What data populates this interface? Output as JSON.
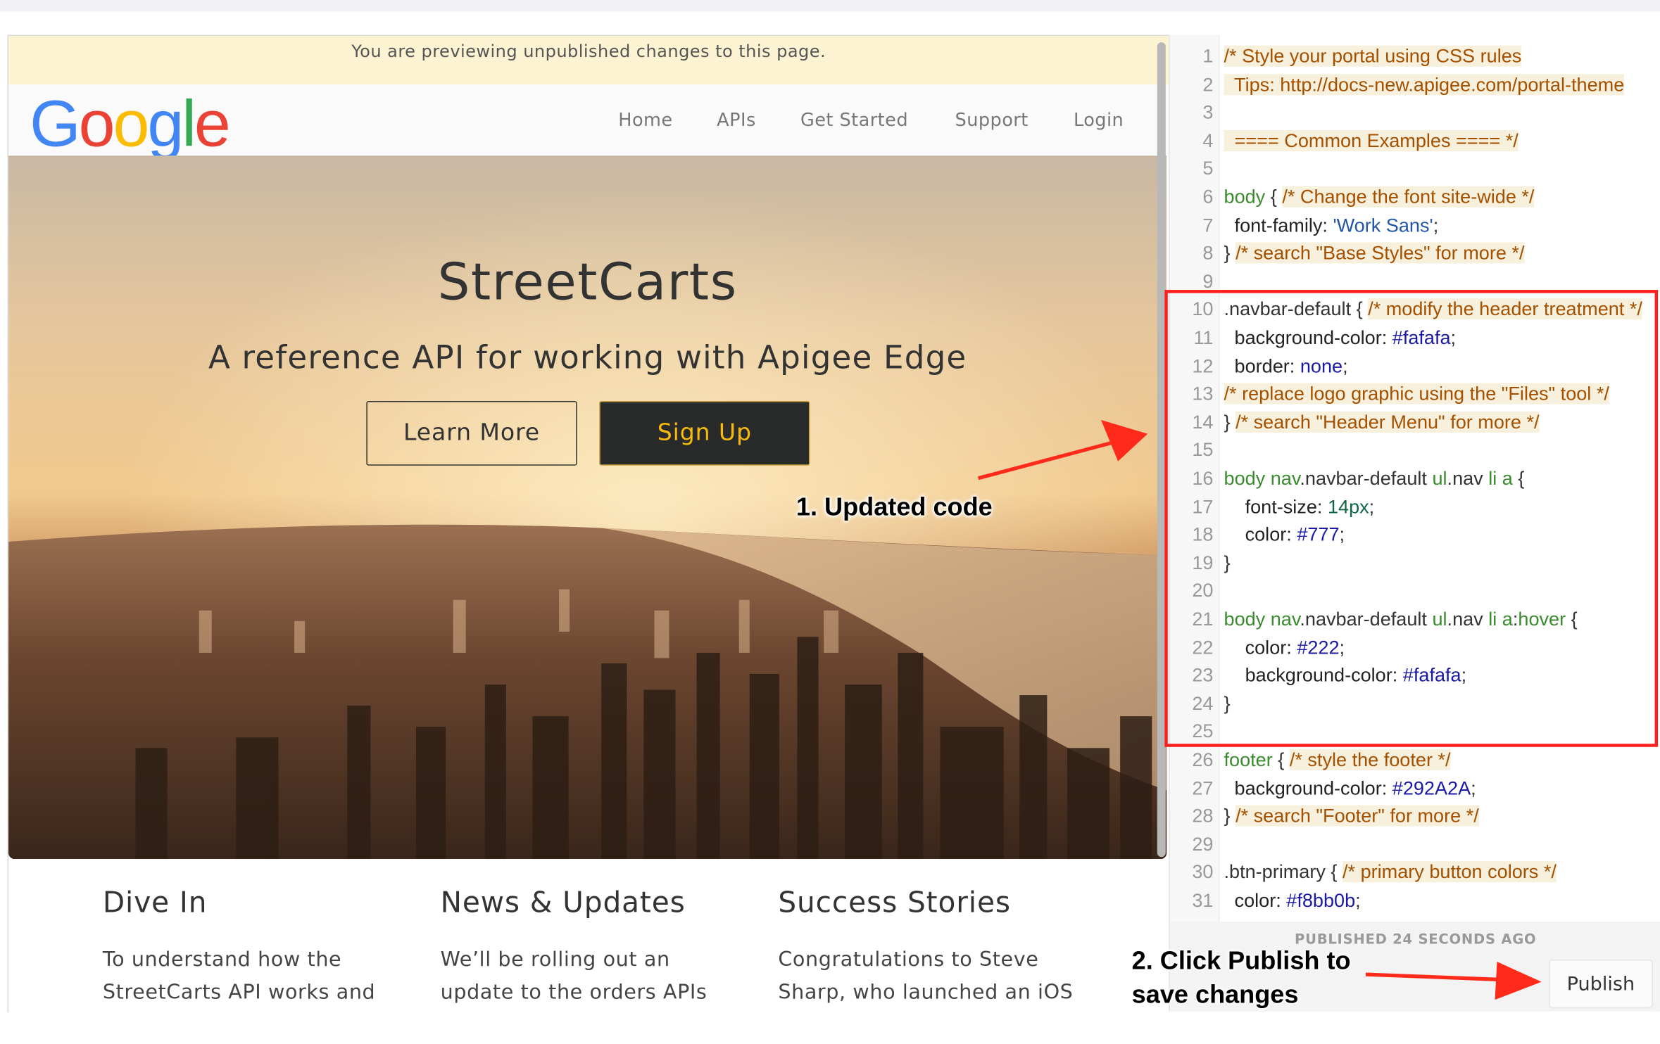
{
  "preview": {
    "banner": "You are previewing unpublished changes to this page.",
    "logo_text": [
      "G",
      "o",
      "o",
      "g",
      "l",
      "e"
    ],
    "logo_colors": [
      "#4285F4",
      "#EA4335",
      "#FBBC05",
      "#4285F4",
      "#34A853",
      "#EA4335"
    ],
    "nav": [
      "Home",
      "APIs",
      "Get Started",
      "Support",
      "Login"
    ],
    "hero": {
      "title": "StreetCarts",
      "subtitle": "A reference API for working with Apigee Edge",
      "learn_more": "Learn More",
      "sign_up": "Sign Up"
    },
    "columns": [
      {
        "title": "Dive In",
        "text_lines": [
          "To understand how the",
          "StreetCarts API works and"
        ]
      },
      {
        "title": "News & Updates",
        "text_lines": [
          "We’ll be rolling out an",
          "update to the orders APIs"
        ]
      },
      {
        "title": "Success Stories",
        "text_lines": [
          "Congratulations to Steve",
          "Sharp, who launched an iOS"
        ]
      }
    ]
  },
  "editor": {
    "lines": [
      {
        "n": "1",
        "tokens": [
          [
            "cm",
            "/* Style your portal using CSS rules"
          ]
        ]
      },
      {
        "n": "2",
        "tokens": [
          [
            "cm",
            "  Tips: http://docs-new.apigee.com/portal-theme"
          ]
        ]
      },
      {
        "n": "3",
        "tokens": []
      },
      {
        "n": "4",
        "tokens": [
          [
            "cm",
            "  ==== Common Examples ==== */"
          ]
        ]
      },
      {
        "n": "5",
        "tokens": []
      },
      {
        "n": "6",
        "tokens": [
          [
            "tag",
            "body"
          ],
          [
            "pl",
            " { "
          ],
          [
            "cm",
            "/* Change the font site-wide */"
          ]
        ]
      },
      {
        "n": "7",
        "tokens": [
          [
            "pr",
            "  font-family: "
          ],
          [
            "str",
            "'Work Sans'"
          ],
          [
            "pl",
            ";"
          ]
        ]
      },
      {
        "n": "8",
        "tokens": [
          [
            "pl",
            "} "
          ],
          [
            "cm",
            "/* search \"Base Styles\" for more */"
          ]
        ]
      },
      {
        "n": "9",
        "tokens": []
      },
      {
        "n": "10",
        "tokens": [
          [
            "pl",
            ".navbar-default { "
          ],
          [
            "cm",
            "/* modify the header treatment */"
          ]
        ]
      },
      {
        "n": "11",
        "tokens": [
          [
            "pr",
            "  background-color: "
          ],
          [
            "val",
            "#fafafa"
          ],
          [
            "pl",
            ";"
          ]
        ]
      },
      {
        "n": "12",
        "tokens": [
          [
            "pr",
            "  border: "
          ],
          [
            "val",
            "none"
          ],
          [
            "pl",
            ";"
          ]
        ]
      },
      {
        "n": "13",
        "tokens": [
          [
            "cm",
            "/* replace logo graphic using the \"Files\" tool */"
          ]
        ]
      },
      {
        "n": "14",
        "tokens": [
          [
            "pl",
            "} "
          ],
          [
            "cm",
            "/* search \"Header Menu\" for more */"
          ]
        ]
      },
      {
        "n": "15",
        "tokens": []
      },
      {
        "n": "16",
        "tokens": [
          [
            "tag",
            "body nav"
          ],
          [
            "pl",
            ".navbar-default "
          ],
          [
            "tag",
            "ul"
          ],
          [
            "pl",
            ".nav "
          ],
          [
            "tag",
            "li a"
          ],
          [
            "pl",
            " {"
          ]
        ]
      },
      {
        "n": "17",
        "tokens": [
          [
            "pr",
            "    font-size: "
          ],
          [
            "num",
            "14px"
          ],
          [
            "pl",
            ";"
          ]
        ]
      },
      {
        "n": "18",
        "tokens": [
          [
            "pr",
            "    color: "
          ],
          [
            "val",
            "#777"
          ],
          [
            "pl",
            ";"
          ]
        ]
      },
      {
        "n": "19",
        "tokens": [
          [
            "pl",
            "}"
          ]
        ]
      },
      {
        "n": "20",
        "tokens": []
      },
      {
        "n": "21",
        "tokens": [
          [
            "tag",
            "body nav"
          ],
          [
            "pl",
            ".navbar-default "
          ],
          [
            "tag",
            "ul"
          ],
          [
            "pl",
            ".nav "
          ],
          [
            "tag",
            "li a"
          ],
          [
            "pl",
            ":"
          ],
          [
            "tag",
            "hover"
          ],
          [
            "pl",
            " {"
          ]
        ]
      },
      {
        "n": "22",
        "tokens": [
          [
            "pr",
            "    color: "
          ],
          [
            "val",
            "#222"
          ],
          [
            "pl",
            ";"
          ]
        ]
      },
      {
        "n": "23",
        "tokens": [
          [
            "pr",
            "    background-color: "
          ],
          [
            "val",
            "#fafafa"
          ],
          [
            "pl",
            ";"
          ]
        ]
      },
      {
        "n": "24",
        "tokens": [
          [
            "pl",
            "}"
          ]
        ]
      },
      {
        "n": "25",
        "tokens": []
      },
      {
        "n": "26",
        "tokens": [
          [
            "tag",
            "footer"
          ],
          [
            "pl",
            " { "
          ],
          [
            "cm",
            "/* style the footer */"
          ]
        ]
      },
      {
        "n": "27",
        "tokens": [
          [
            "pr",
            "  background-color: "
          ],
          [
            "val",
            "#292A2A"
          ],
          [
            "pl",
            ";"
          ]
        ]
      },
      {
        "n": "28",
        "tokens": [
          [
            "pl",
            "} "
          ],
          [
            "cm",
            "/* search \"Footer\" for more */"
          ]
        ]
      },
      {
        "n": "29",
        "tokens": []
      },
      {
        "n": "30",
        "tokens": [
          [
            "pl",
            ".btn-primary { "
          ],
          [
            "cm",
            "/* primary button colors */"
          ]
        ]
      },
      {
        "n": "31",
        "tokens": [
          [
            "pr",
            "  color: "
          ],
          [
            "val",
            "#f8bb0b"
          ],
          [
            "pl",
            ";"
          ]
        ]
      }
    ],
    "status": "PUBLISHED 24 SECONDS AGO",
    "publish_label": "Publish"
  },
  "annotations": {
    "step1": "1. Updated code",
    "step2_line1": "2. Click Publish to",
    "step2_line2": "save changes",
    "color": "#ff1f1f"
  }
}
